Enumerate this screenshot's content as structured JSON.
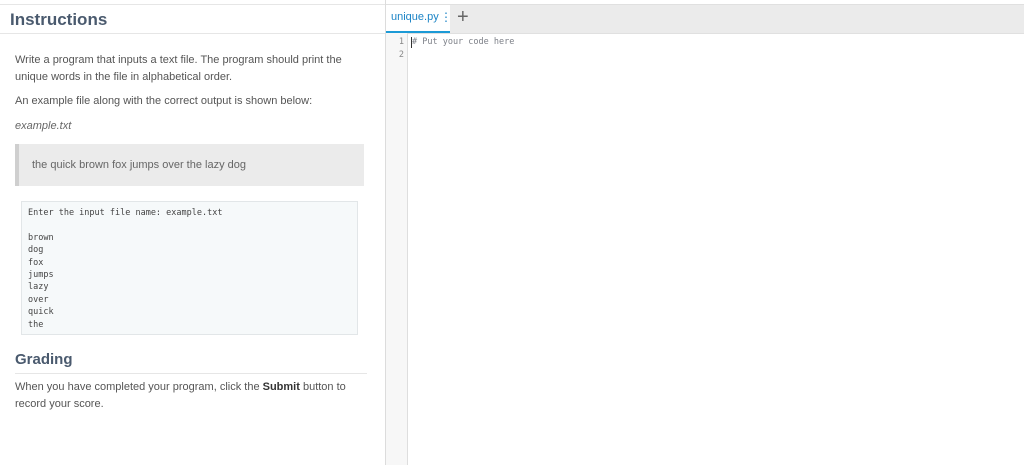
{
  "instructions": {
    "title": "Instructions",
    "paragraph1": "Write a program that inputs a text file. The program should print the unique words in the file in alphabetical order.",
    "paragraph2": "An example file along with the correct output is shown below:",
    "example_filename": "example.txt",
    "example_contents": "the quick brown fox jumps over the lazy dog",
    "sample_output": [
      "Enter the input file name: example.txt",
      "",
      "brown",
      "dog",
      "fox",
      "jumps",
      "lazy",
      "over",
      "quick",
      "the"
    ]
  },
  "grading": {
    "title": "Grading",
    "text_before": "When you have completed your program, click the ",
    "submit_word": "Submit",
    "text_after": " button to record your score."
  },
  "editor": {
    "tab_name": "unique.py",
    "tab_menu_icon": "vertical-ellipsis-icon",
    "add_tab_icon": "plus-icon",
    "line_numbers": [
      "1",
      "2"
    ],
    "code_lines": [
      "# Put your code here",
      ""
    ]
  },
  "colors": {
    "heading": "#4a5a6e",
    "tab_accent": "#1c9ad6"
  }
}
